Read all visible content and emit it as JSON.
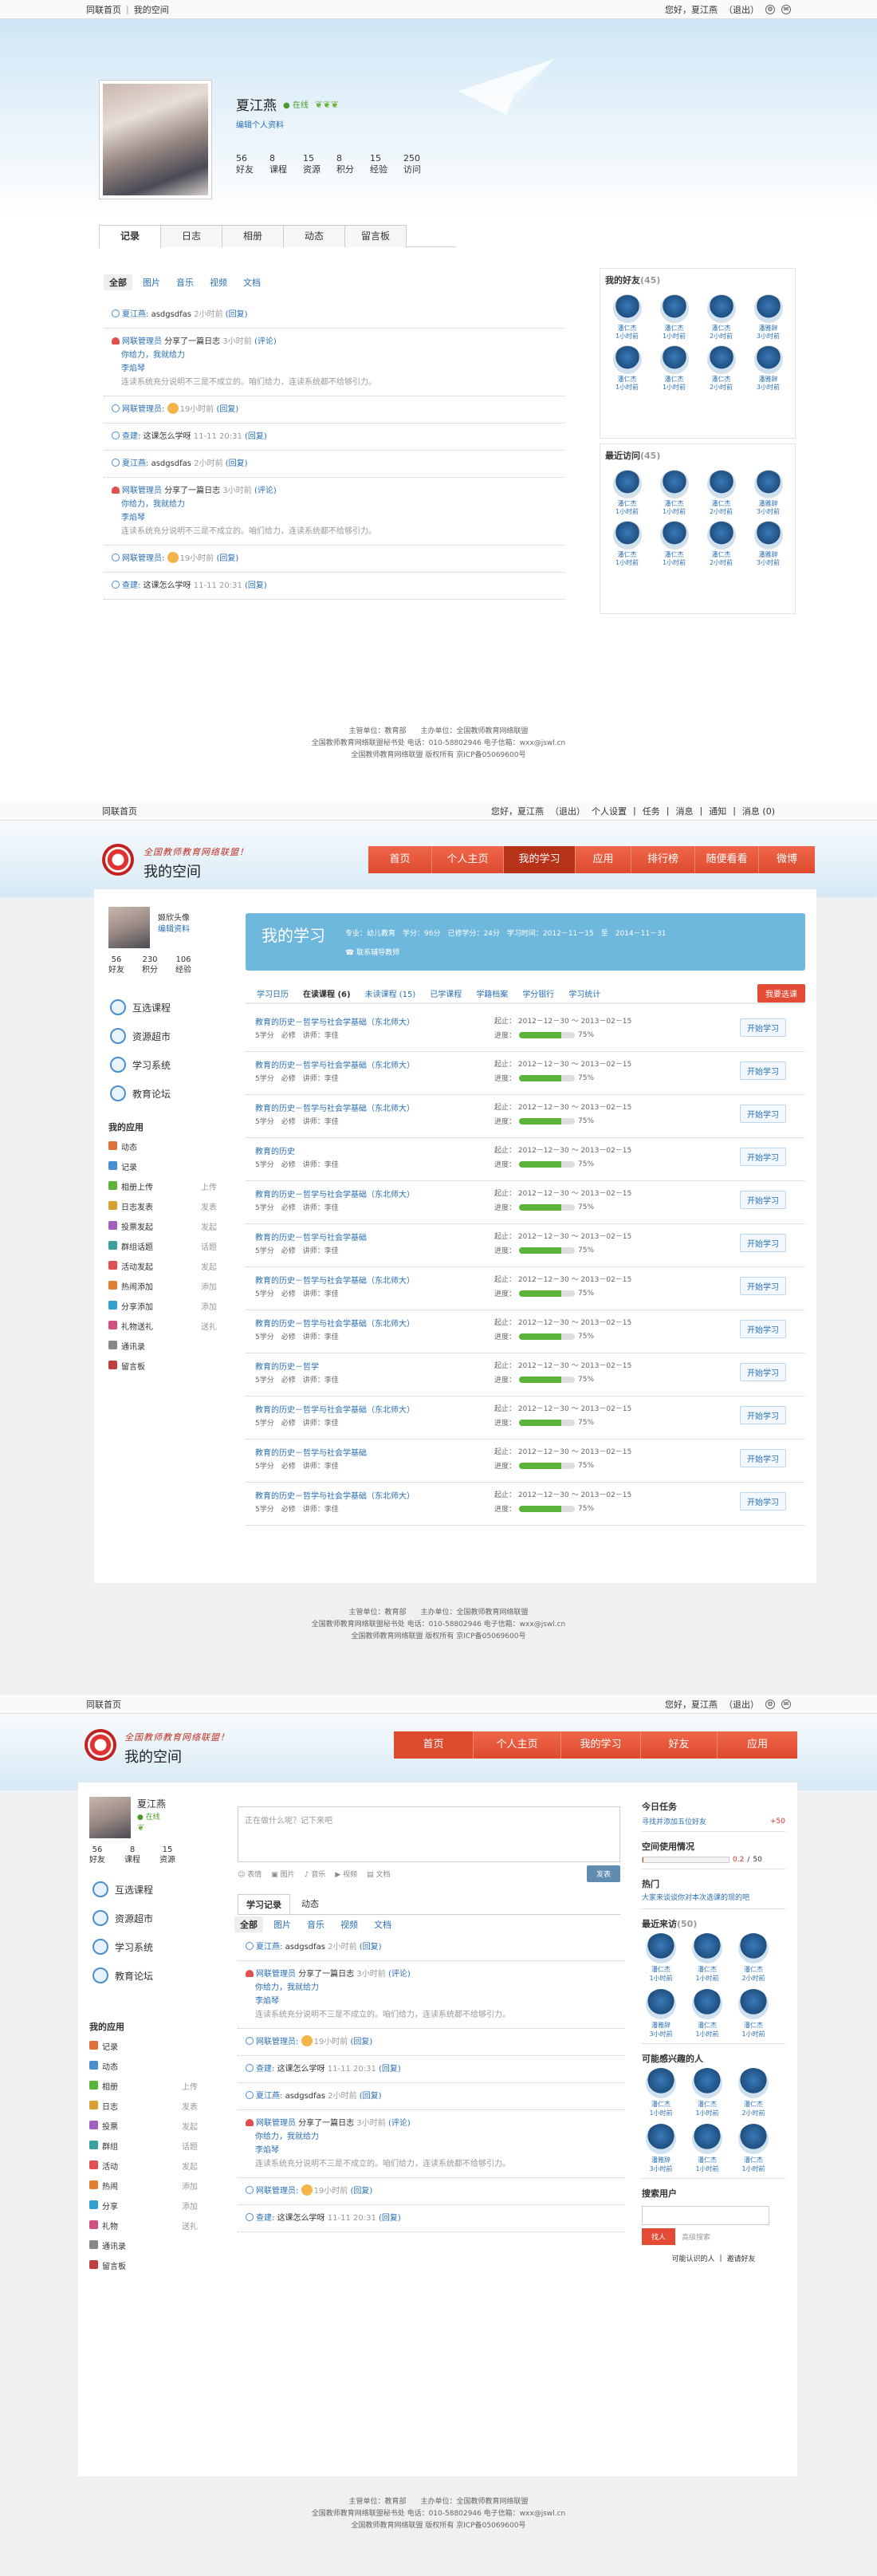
{
  "s1": {
    "top": {
      "left1": "同联首页",
      "left2": "我的空间",
      "greet": "您好，夏江燕",
      "logout": "（退出）"
    },
    "name": "夏江燕",
    "online": "在线",
    "edit": "编辑个人资料",
    "stats": [
      {
        "n": "56",
        "l": "好友"
      },
      {
        "n": "8",
        "l": "课程"
      },
      {
        "n": "15",
        "l": "资源"
      },
      {
        "n": "8",
        "l": "积分"
      },
      {
        "n": "15",
        "l": "经验"
      },
      {
        "n": "250",
        "l": "访问"
      }
    ],
    "tabs": [
      "记录",
      "日志",
      "相册",
      "动态",
      "留言板"
    ],
    "subtabs": [
      "全部",
      "图片",
      "音乐",
      "视频",
      "文档"
    ],
    "feed": [
      {
        "a": "夏江燕:",
        "b": "asdgsdfas",
        "c": "2小时前",
        "d": "(回复)"
      },
      {
        "a": "网联管理员",
        "b": "分享了一篇日志",
        "c": "3小时前",
        "d": "(评论)",
        "s1": "你给力，我就给力",
        "s2": "李焰琴",
        "s3": "连读系统充分说明不三是不成立的。咱们给力，连读系统都不给够引力。"
      },
      {
        "a": "网联管理员:",
        "c": "19小时前",
        "d": "(回复)"
      },
      {
        "a": "查建:",
        "b": "这课怎么学呀",
        "c": "11-11 20:31",
        "d": "(回复)"
      },
      {
        "a": "夏江燕:",
        "b": "asdgsdfas",
        "c": "2小时前",
        "d": "(回复)"
      },
      {
        "a": "网联管理员",
        "b": "分享了一篇日志",
        "c": "3小时前",
        "d": "(评论)",
        "s1": "你给力，我就给力",
        "s2": "李焰琴",
        "s3": "连读系统充分说明不三是不成立的。咱们给力，连读系统都不给够引力。"
      },
      {
        "a": "网联管理员:",
        "c": "19小时前",
        "d": "(回复)"
      },
      {
        "a": "查建:",
        "b": "这课怎么学呀",
        "c": "11-11 20:31",
        "d": "(回复)"
      }
    ],
    "friends_title": "我的好友",
    "friends_count": "(45)",
    "visitors_title": "最近访问",
    "visitors_count": "(45)",
    "people": [
      {
        "n": "潘仁杰",
        "t": "1小时前"
      },
      {
        "n": "潘仁杰",
        "t": "1小时前"
      },
      {
        "n": "潘仁杰",
        "t": "2小时前"
      },
      {
        "n": "潘雅辞",
        "t": "3小时前"
      },
      {
        "n": "潘仁杰",
        "t": "1小时前"
      },
      {
        "n": "潘仁杰",
        "t": "1小时前"
      },
      {
        "n": "潘仁杰",
        "t": "2小时前"
      },
      {
        "n": "潘雅辞",
        "t": "3小时前"
      }
    ],
    "footer": [
      "主管单位：教育部　　主办单位：全国教师教育网络联盟",
      "全国教师教育网络联盟秘书处 电话：010-58802946 电子信箱：wxx@jswl.cn",
      "全国教师教育网络联盟 版权所有 京ICP备05069600号"
    ]
  },
  "s2": {
    "top": {
      "left": "同联首页",
      "greet": "您好，夏江燕",
      "logout": "（退出）",
      "links": [
        "个人设置",
        "任务",
        "消息",
        "通知",
        "消息 (0)"
      ]
    },
    "slogan": "全国教师教育网络联盟！",
    "title": "我的空间",
    "nav": [
      "首页",
      "个人主页",
      "我的学习",
      "应用",
      "排行榜",
      "随便看看",
      "微博"
    ],
    "user": {
      "name1": "姬欣头像",
      "name2": "编辑资料",
      "stats": [
        {
          "n": "56",
          "l": "好友"
        },
        {
          "n": "230",
          "l": "积分"
        },
        {
          "n": "106",
          "l": "经验"
        }
      ]
    },
    "menu": [
      "互选课程",
      "资源超市",
      "学习系统",
      "教育论坛"
    ],
    "apps_title": "我的应用",
    "apps": [
      {
        "n": "动态",
        "a": ""
      },
      {
        "n": "记录",
        "a": ""
      },
      {
        "n": "相册上传",
        "a": "上传"
      },
      {
        "n": "日志发表",
        "a": "发表"
      },
      {
        "n": "投票发起",
        "a": "发起"
      },
      {
        "n": "群组话题",
        "a": "话题"
      },
      {
        "n": "活动发起",
        "a": "发起"
      },
      {
        "n": "热闹添加",
        "a": "添加"
      },
      {
        "n": "分享添加",
        "a": "添加"
      },
      {
        "n": "礼物送礼",
        "a": "送礼"
      },
      {
        "n": "通讯录",
        "a": ""
      },
      {
        "n": "留言板",
        "a": ""
      }
    ],
    "head": {
      "title": "我的学习",
      "meta": "专业：幼儿教育　学分：96分　已修学分：24分　学习时间：2012－11－15　至　2014－11－31",
      "contact": "联系辅导教师"
    },
    "ctabs": [
      "学习日历",
      "在读课程 (6)",
      "未读课程 (15)",
      "已学课程",
      "学籍档案",
      "学分银行",
      "学习统计"
    ],
    "select_btn": "我要选课",
    "courses": [
      {
        "n": "教育的历史－哲学与社会学基础（东北师大）",
        "d": "5学分　必修　讲师：李佳",
        "s": "起止：",
        "s1": "2012－12－30",
        "s2": "2013－02－15",
        "p": "进度：",
        "v": "75%",
        "b": "开始学习"
      },
      {
        "n": "教育的历史－哲学与社会学基础（东北师大）",
        "d": "5学分　必修　讲师：李佳",
        "s": "起止：",
        "s1": "2012－12－30",
        "s2": "2013－02－15",
        "p": "进度：",
        "v": "75%",
        "b": "开始学习"
      },
      {
        "n": "教育的历史－哲学与社会学基础（东北师大）",
        "d": "5学分　必修　讲师：李佳",
        "s": "起止：",
        "s1": "2012－12－30",
        "s2": "2013－02－15",
        "p": "进度：",
        "v": "75%",
        "b": "开始学习"
      },
      {
        "n": "教育的历史",
        "d": "5学分　必修　讲师：李佳",
        "s": "起止：",
        "s1": "2012－12－30",
        "s2": "2013－02－15",
        "p": "进度：",
        "v": "75%",
        "b": "开始学习"
      },
      {
        "n": "教育的历史－哲学与社会学基础（东北师大）",
        "d": "5学分　必修　讲师：李佳",
        "s": "起止：",
        "s1": "2012－12－30",
        "s2": "2013－02－15",
        "p": "进度：",
        "v": "75%",
        "b": "开始学习"
      },
      {
        "n": "教育的历史－哲学与社会学基础",
        "d": "5学分　必修　讲师：李佳",
        "s": "起止：",
        "s1": "2012－12－30",
        "s2": "2013－02－15",
        "p": "进度：",
        "v": "75%",
        "b": "开始学习"
      },
      {
        "n": "教育的历史－哲学与社会学基础（东北师大）",
        "d": "5学分　必修　讲师：李佳",
        "s": "起止：",
        "s1": "2012－12－30",
        "s2": "2013－02－15",
        "p": "进度：",
        "v": "75%",
        "b": "开始学习"
      },
      {
        "n": "教育的历史－哲学与社会学基础（东北师大）",
        "d": "5学分　必修　讲师：李佳",
        "s": "起止：",
        "s1": "2012－12－30",
        "s2": "2013－02－15",
        "p": "进度：",
        "v": "75%",
        "b": "开始学习"
      },
      {
        "n": "教育的历史－哲学",
        "d": "5学分　必修　讲师：李佳",
        "s": "起止：",
        "s1": "2012－12－30",
        "s2": "2013－02－15",
        "p": "进度：",
        "v": "75%",
        "b": "开始学习"
      },
      {
        "n": "教育的历史－哲学与社会学基础（东北师大）",
        "d": "5学分　必修　讲师：李佳",
        "s": "起止：",
        "s1": "2012－12－30",
        "s2": "2013－02－15",
        "p": "进度：",
        "v": "75%",
        "b": "开始学习"
      },
      {
        "n": "教育的历史－哲学与社会学基础",
        "d": "5学分　必修　讲师：李佳",
        "s": "起止：",
        "s1": "2012－12－30",
        "s2": "2013－02－15",
        "p": "进度：",
        "v": "75%",
        "b": "开始学习"
      },
      {
        "n": "教育的历史－哲学与社会学基础（东北师大）",
        "d": "5学分　必修　讲师：李佳",
        "s": "起止：",
        "s1": "2012－12－30",
        "s2": "2013－02－15",
        "p": "进度：",
        "v": "75%",
        "b": "开始学习"
      }
    ],
    "progress": 0.75
  },
  "s3": {
    "top": {
      "left": "同联首页",
      "greet": "您好，夏江燕",
      "logout": "（退出）"
    },
    "slogan": "全国教师教育网络联盟！",
    "title": "我的空间",
    "nav": [
      "首页",
      "个人主页",
      "我的学习",
      "好友",
      "应用"
    ],
    "user": {
      "name": "夏江燕",
      "online": "在线",
      "stats": [
        {
          "n": "56",
          "l": "好友"
        },
        {
          "n": "8",
          "l": "课程"
        },
        {
          "n": "15",
          "l": "资源"
        }
      ]
    },
    "menu": [
      "互选课程",
      "资源超市",
      "学习系统",
      "教育论坛"
    ],
    "apps_title": "我的应用",
    "apps": [
      {
        "n": "记录",
        "a": ""
      },
      {
        "n": "动态",
        "a": ""
      },
      {
        "n": "相册",
        "a": "上传"
      },
      {
        "n": "日志",
        "a": "发表"
      },
      {
        "n": "投票",
        "a": "发起"
      },
      {
        "n": "群组",
        "a": "话题"
      },
      {
        "n": "活动",
        "a": "发起"
      },
      {
        "n": "热闹",
        "a": "添加"
      },
      {
        "n": "分享",
        "a": "添加"
      },
      {
        "n": "礼物",
        "a": "送礼"
      },
      {
        "n": "通讯录",
        "a": ""
      },
      {
        "n": "留言板",
        "a": ""
      }
    ],
    "post_placeholder": "正在做什么呢？记下来吧",
    "post_tools": [
      "表情",
      "图片",
      "音乐",
      "视频",
      "文档"
    ],
    "post_btn": "发表",
    "tabs": [
      "学习记录",
      "动态"
    ],
    "today": {
      "title": "今日任务",
      "task": "寻找并添加五位好友",
      "pts": "+50"
    },
    "space": {
      "title": "空间使用情况",
      "used": "0.2",
      "total": "50"
    },
    "hot": {
      "title": "热门",
      "text": "大家来谈谈你对本次选课的现的吧"
    },
    "visitors_title": "最近来访",
    "visitors_count": "(50)",
    "maybe_title": "可能感兴趣的人",
    "search": {
      "title": "搜索用户",
      "btn": "找人",
      "ph": "高级搜索",
      "links": [
        "可能认识的人",
        "邀请好友"
      ]
    }
  }
}
